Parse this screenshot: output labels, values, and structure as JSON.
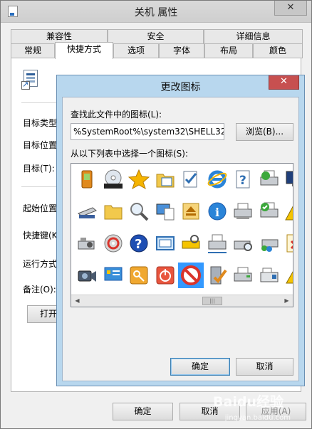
{
  "window": {
    "title": "关机 属性",
    "close_glyph": "✕"
  },
  "tabs": {
    "row1": [
      "兼容性",
      "安全",
      "详细信息"
    ],
    "row2": [
      "常规",
      "快捷方式",
      "选项",
      "字体",
      "布局",
      "颜色"
    ],
    "active": "快捷方式"
  },
  "properties": {
    "labels": [
      "目标类型",
      "目标位置",
      "目标(T):",
      "起始位置",
      "快捷键(K",
      "运行方式",
      "备注(O):"
    ],
    "open_button": "打开"
  },
  "footer": {
    "ok": "确定",
    "cancel": "取消",
    "apply": "应用(A)"
  },
  "dialog": {
    "title": "更改图标",
    "close_glyph": "✕",
    "file_label": "查找此文件中的图标(L):",
    "file_path": "%SystemRoot%\\system32\\SHELL32.dll",
    "browse_button": "浏览(B)...",
    "list_label": "从以下列表中选择一个图标(S):",
    "ok": "确定",
    "cancel": "取消",
    "icons": [
      [
        "phone-icon",
        "dvd-rw-icon",
        "star-icon",
        "folder-calendar-icon",
        "checklist-icon",
        "internet-explorer-icon",
        "help-document-icon",
        "printer-go-icon",
        "monitor-icon"
      ],
      [
        "scanner-icon",
        "folder-icon",
        "magnifier-icon",
        "computer-document-icon",
        "eject-icon",
        "info-icon",
        "fax-printer-icon",
        "printer-check-icon",
        "warning-icon"
      ],
      [
        "projector-icon",
        "cd-rom-icon",
        "help-icon",
        "screen-icon",
        "key-device-icon",
        "network-printer-icon",
        "printer-search-icon",
        "printer-users-icon",
        "error-document-icon"
      ],
      [
        "camcorder-icon",
        "control-panel-icon",
        "key-icon",
        "power-icon",
        "no-entry-icon",
        "server-check-icon",
        "printer-fax-icon",
        "fax-machine-icon",
        "warning-small-icon"
      ]
    ],
    "selected_icon": "no-entry-icon"
  },
  "watermark": {
    "text": "Baidu经验",
    "sub": "jingyan.baidu.com"
  },
  "colors": {
    "selection": "#3399ff",
    "dialog_frame": "#b8d7ee",
    "close_red": "#c75050"
  }
}
